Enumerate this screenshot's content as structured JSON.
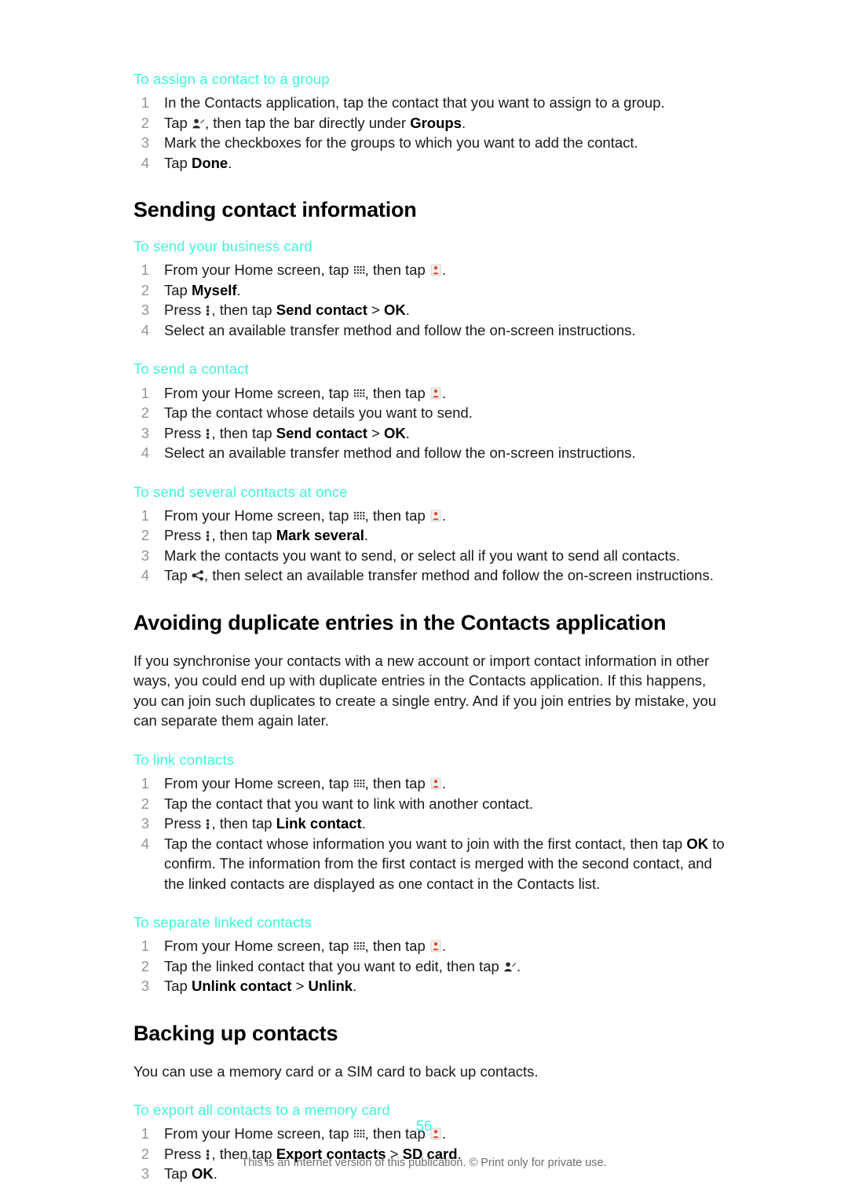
{
  "page": {
    "number": "56",
    "footer_note": "This is an Internet version of this publication. © Print only for private use."
  },
  "icons": {
    "app_drawer": "app-drawer-icon",
    "contacts": "contacts-icon",
    "menu_key": "menu-key-icon",
    "edit_contact": "edit-contact-icon",
    "share": "share-icon"
  },
  "colors": {
    "heading_accent": "#3DF7DD",
    "body_text": "#1A1A1A",
    "step_number": "#949494",
    "footer_note": "#6E6E6E"
  },
  "sections": {
    "assign_group": {
      "sub_head": "To assign a contact to a group",
      "steps": {
        "s1": "In the Contacts application, tap the contact that you want to assign to a group.",
        "s2_a": "Tap ",
        "s2_b": ", then tap the bar directly under ",
        "s2_bold": "Groups",
        "s2_c": ".",
        "s3": "Mark the checkboxes for the groups to which you want to add the contact.",
        "s4_a": "Tap ",
        "s4_bold": "Done",
        "s4_b": "."
      }
    },
    "sending_contact_information": {
      "title": "Sending contact information",
      "business_card": {
        "sub_head": "To send your business card",
        "steps": {
          "s1_a": "From your Home screen, tap ",
          "s1_b": ", then tap ",
          "s1_c": ".",
          "s2_a": "Tap ",
          "s2_bold": "Myself",
          "s2_b": ".",
          "s3_a": "Press ",
          "s3_b": ", then tap ",
          "s3_bold1": "Send contact",
          "s3_c": " > ",
          "s3_bold2": "OK",
          "s3_d": ".",
          "s4": "Select an available transfer method and follow the on-screen instructions."
        }
      },
      "send_contact": {
        "sub_head": "To send a contact",
        "steps": {
          "s1_a": "From your Home screen, tap ",
          "s1_b": ", then tap ",
          "s1_c": ".",
          "s2": "Tap the contact whose details you want to send.",
          "s3_a": "Press ",
          "s3_b": ", then tap ",
          "s3_bold1": "Send contact",
          "s3_c": " > ",
          "s3_bold2": "OK",
          "s3_d": ".",
          "s4": "Select an available transfer method and follow the on-screen instructions."
        }
      },
      "send_several": {
        "sub_head": "To send several contacts at once",
        "steps": {
          "s1_a": "From your Home screen, tap ",
          "s1_b": ", then tap ",
          "s1_c": ".",
          "s2_a": "Press ",
          "s2_b": ", then tap ",
          "s2_bold": "Mark several",
          "s2_c": ".",
          "s3": "Mark the contacts you want to send, or select all if you want to send all contacts.",
          "s4_a": "Tap ",
          "s4_b": ", then select an available transfer method and follow the on-screen instructions."
        }
      }
    },
    "avoiding_duplicates": {
      "title": "Avoiding duplicate entries in the Contacts application",
      "intro": "If you synchronise your contacts with a new account or import contact information in other ways, you could end up with duplicate entries in the Contacts application. If this happens, you can join such duplicates to create a single entry. And if you join entries by mistake, you can separate them again later.",
      "link_contacts": {
        "sub_head": "To link contacts",
        "steps": {
          "s1_a": "From your Home screen, tap ",
          "s1_b": ", then tap ",
          "s1_c": ".",
          "s2": "Tap the contact that you want to link with another contact.",
          "s3_a": "Press ",
          "s3_b": ", then tap ",
          "s3_bold": "Link contact",
          "s3_c": ".",
          "s4_a": "Tap the contact whose information you want to join with the first contact, then tap ",
          "s4_bold": "OK",
          "s4_b": " to confirm. The information from the first contact is merged with the second contact, and the linked contacts are displayed as one contact in the Contacts list."
        }
      },
      "separate_contacts": {
        "sub_head": "To separate linked contacts",
        "steps": {
          "s1_a": "From your Home screen, tap ",
          "s1_b": ", then tap ",
          "s1_c": ".",
          "s2_a": "Tap the linked contact that you want to edit, then tap ",
          "s2_b": ".",
          "s3_a": "Tap ",
          "s3_bold1": "Unlink contact",
          "s3_b": " > ",
          "s3_bold2": "Unlink",
          "s3_c": "."
        }
      }
    },
    "backing_up": {
      "title": "Backing up contacts",
      "intro": "You can use a memory card or a SIM card to back up contacts.",
      "export_memory_card": {
        "sub_head": "To export all contacts to a memory card",
        "steps": {
          "s1_a": "From your Home screen, tap ",
          "s1_b": ", then tap ",
          "s1_c": ".",
          "s2_a": "Press ",
          "s2_b": ", then tap ",
          "s2_bold1": "Export contacts",
          "s2_c": " > ",
          "s2_bold2": "SD card",
          "s2_d": ".",
          "s3_a": "Tap ",
          "s3_bold": "OK",
          "s3_b": "."
        }
      }
    }
  }
}
